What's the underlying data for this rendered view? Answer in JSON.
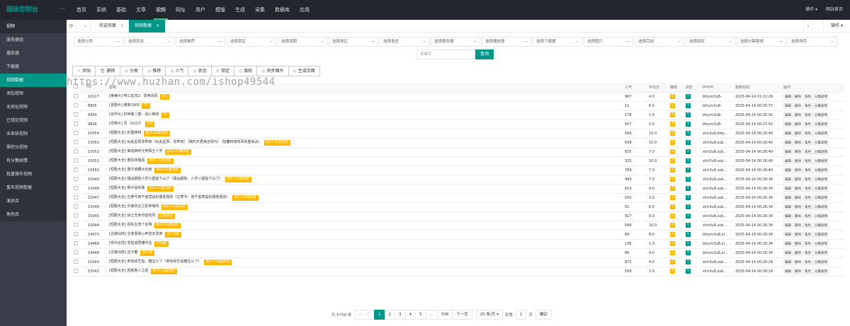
{
  "app": {
    "logo": "超级控制台",
    "menu_icon": "menu-icon"
  },
  "topnav": [
    "首页",
    "系统",
    "基础",
    "文章",
    "视频",
    "网址",
    "用户",
    "模版",
    "生成",
    "采集",
    "数据库",
    "应用"
  ],
  "topnav_active": 4,
  "topright": {
    "ops": "操作 ▾",
    "home": "网站首页"
  },
  "sidebar": {
    "items": [
      "视频",
      "服务器组",
      "播放器",
      "下载器",
      "视频数据",
      "添加视频",
      "无地址视频",
      "已锁定视频",
      "未审核视频",
      "需积分视频",
      "有分集剧情",
      "批量操作视频",
      "重名视频数据",
      "演员库",
      "角色库"
    ]
  },
  "tabs": {
    "home": "欢迎页面",
    "video": "视频数据",
    "ops": "操作 ▾"
  },
  "filters": [
    "选择分类",
    "选择状态",
    "选择推荐",
    "选择锁定",
    "选择周期",
    "选择地区",
    "选择语言",
    "选择服务器",
    "选择播放器",
    "选择下载器",
    "选择图片",
    "选择完结",
    "选择版权",
    "选择分集剧情",
    "选择排序"
  ],
  "keyword_placeholder": "关键字",
  "query": "查询",
  "actions": [
    "添加",
    "删除",
    "分类",
    "推荐",
    "人气",
    "状态",
    "锁定",
    "版权",
    "同步图片",
    "生成页面"
  ],
  "watermark": "https://www.huzhan.com/ishop49544",
  "columns": [
    "",
    "ID",
    "名称",
    "人气",
    "平均分",
    "推荐",
    "浏览",
    "player",
    "更新时间",
    "操作"
  ],
  "rows": [
    {
      "id": "10127",
      "name": "[奥美片] 特工狂花2：雷电杀机",
      "ep": "HD",
      "hits": "967",
      "score": "4.0",
      "rec": "0",
      "view": "Y",
      "player": "bfzym3u8-",
      "time": "2025-04-14 01:22:29"
    },
    {
      "id": "8905",
      "name": "[喜剧片] 奥斯1900",
      "ep": "TC",
      "hits": "11",
      "score": "6.0",
      "rec": "0",
      "view": "Y",
      "player": "bfzym3u8-",
      "time": "2025-04-14 00:35:37"
    },
    {
      "id": "8904",
      "name": "[动作片] 封神第二部：战火西岐",
      "ep": "TC",
      "hits": "178",
      "score": "1.0",
      "rec": "0",
      "view": "Y",
      "player": "bfzym3u8-",
      "time": "2025-04-14 00:35:02"
    },
    {
      "id": "9826",
      "name": "[恐怖片] 咒（2022）",
      "ep": "HD",
      "hits": "507",
      "score": "5.0",
      "rec": "0",
      "view": "Y",
      "player": "bfzym3u8-",
      "time": "2025-04-14 00:27:52"
    },
    {
      "id": "15054",
      "name": "[短剧大全] 护国神将",
      "ep": "第41-60集完结",
      "hits": "569",
      "score": "10.0",
      "rec": "0",
      "view": "Y",
      "player": "xlm3u8,bfzy...",
      "time": "2025-04-14 00:26:40"
    },
    {
      "id": "15053",
      "name": "[短剧大全] 似此星辰非昨夜（似此星辰、非昨夜）（我的天君来自现代）（智囊权谋将军的重来夫）",
      "ep": "第61-81集完结",
      "hits": "638",
      "score": "10.0",
      "rec": "0",
      "view": "Y",
      "player": "xlm3u8,sub...",
      "time": "2025-04-14 00:26:40"
    },
    {
      "id": "15052",
      "name": "[短剧大全] 离谊神听光势情五十岁",
      "ep": "第41-57集完结",
      "hits": "825",
      "score": "7.0",
      "rec": "0",
      "view": "Y",
      "player": "xlm3u8,sub...",
      "time": "2025-04-14 00:26:40"
    },
    {
      "id": "15051",
      "name": "[短剧大全] 春风戏唱看",
      "ep": "第61-74集完结",
      "hits": "325",
      "score": "10.0",
      "rec": "0",
      "view": "Y",
      "player": "xlm3u8,sub...",
      "time": "2025-04-14 00:26:40"
    },
    {
      "id": "15050",
      "name": "[短剧大全] 重华收藏大玩家",
      "ep": "第61-81集完结",
      "hits": "789",
      "score": "7.0",
      "rec": "0",
      "view": "Y",
      "player": "xlm3u8,sub...",
      "time": "2025-04-14 00:26:40"
    },
    {
      "id": "15049",
      "name": "[短剧大全] 福运嗣娃六岁小曼姑下山了（福运嗣娃：六岁小曼姑下山了）",
      "ep": "第61-90集完结",
      "hits": "499",
      "score": "7.0",
      "rec": "0",
      "view": "Y",
      "player": "xlm3u8,sub...",
      "time": "2025-04-14 00:26:34"
    },
    {
      "id": "15048",
      "name": "[短剧大全] 我不是你妹",
      "ep": "第41-67集完结",
      "hits": "619",
      "score": "4.0",
      "rec": "0",
      "view": "Y",
      "player": "xlm3u8,sub...",
      "time": "2025-04-14 00:26:34"
    },
    {
      "id": "15047",
      "name": "[短剧大全] 古穿今真千金竟是封疆老祖宗（古穿今：真千金竟是封疆老祖宗）",
      "ep": "第61-84集完结",
      "hits": "500",
      "score": "2.0",
      "rec": "0",
      "view": "Y",
      "player": "xlm3u8,sub...",
      "time": "2025-04-14 00:26:34"
    },
    {
      "id": "15046",
      "name": "[短剧大全] 次第风云之别拿嗓吗",
      "ep": "第41-51集完结",
      "hits": "51",
      "score": "6.0",
      "rec": "0",
      "view": "Y",
      "player": "xlm3u8,sub...",
      "time": "2025-04-14 00:26:34"
    },
    {
      "id": "15045",
      "name": "[短剧大全] 战士无亲归途有风",
      "ep": "全集完结",
      "hits": "917",
      "score": "9.0",
      "rec": "0",
      "view": "Y",
      "player": "xlm3u8,sub...",
      "time": "2025-04-14 00:26:34"
    },
    {
      "id": "15044",
      "name": "[短剧大全] 祁先生您个证明",
      "ep": "第41-60集完结",
      "hits": "584",
      "score": "10.0",
      "rec": "0",
      "view": "Y",
      "player": "xlm3u8,sub...",
      "time": "2025-04-14 00:26:34"
    },
    {
      "id": "14473",
      "name": "[古装仙侠] 全家靠我心声逆天改命",
      "ep": "全100集",
      "hits": "89",
      "score": "8.0",
      "rec": "0",
      "view": "Y",
      "player": "bfzym3u8,xl...",
      "time": "2025-04-14 00:26:34"
    },
    {
      "id": "14468",
      "name": "[现代言情] 零售成层珊作业",
      "ep": "全60集",
      "hits": "136",
      "score": "1.0",
      "rec": "0",
      "view": "Y",
      "player": "bfzym3u8,xl...",
      "time": "2025-04-14 00:26:34"
    },
    {
      "id": "14448",
      "name": "[古装仙侠] 这子戴",
      "ep": "全83集",
      "hits": "86",
      "score": "4.0",
      "rec": "0",
      "view": "Y",
      "player": "bfzym3u8,xl...",
      "time": "2025-04-14 00:26:34"
    },
    {
      "id": "15043",
      "name": "[短剧大全] 参加综艺后、糖宝火了（参加综艺后糖宝火了）",
      "ep": "第81-100集完结",
      "hits": "873",
      "score": "4.0",
      "rec": "0",
      "view": "Y",
      "player": "xlm3u8,sub...",
      "time": "2025-04-14 00:26:29"
    },
    {
      "id": "15042",
      "name": "[短剧大全] 回到救人之前",
      "ep": "第21-30集完结",
      "hits": "509",
      "score": "2.0",
      "rec": "0",
      "view": "Y",
      "player": "xlm3u8,sub...",
      "time": "2025-04-14 00:26:29"
    }
  ],
  "row_ops": [
    "编辑",
    "删除",
    "角色",
    "分集剧情"
  ],
  "pager": {
    "total": "共 6758 条",
    "prev": "上一页",
    "pages": [
      "1",
      "2",
      "3",
      "4",
      "5",
      "...",
      "338"
    ],
    "next": "下一页",
    "size": "20 条/页 ▾",
    "goto": "到第",
    "page_val": "1",
    "page_unit": "页",
    "confirm": "确定"
  },
  "colors": {
    "accent": "#009688",
    "topbar": "#23262e",
    "sidebar": "#393d49",
    "tag": "#FFB800"
  }
}
